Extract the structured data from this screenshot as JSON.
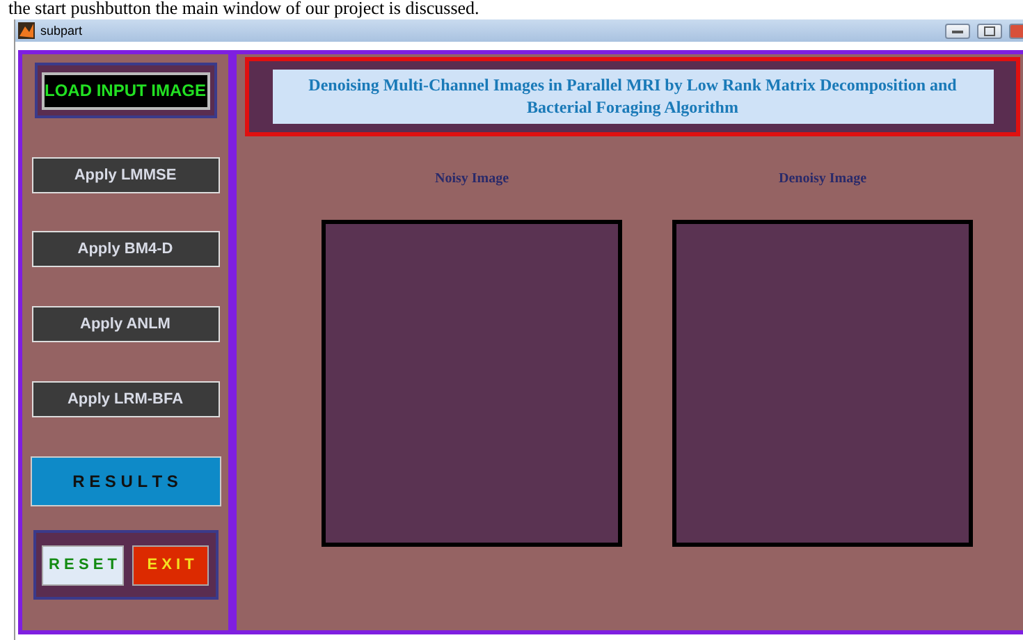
{
  "caption": "the start pushbutton the main window of our project is discussed.",
  "window": {
    "title": "subpart"
  },
  "sidebar": {
    "load_button": "LOAD INPUT IMAGE",
    "method_buttons": [
      "Apply LMMSE",
      "Apply BM4-D",
      "Apply ANLM",
      "Apply LRM-BFA"
    ],
    "results_button": "R E S U L T S",
    "reset_button": "R E S E T",
    "exit_button": "E X I T"
  },
  "header": {
    "title": "Denoising Multi-Channel Images in Parallel MRI by Low Rank Matrix Decomposition and Bacterial Foraging Algorithm"
  },
  "panels": [
    {
      "label": "Noisy Image"
    },
    {
      "label": "Denoisy Image"
    }
  ]
}
